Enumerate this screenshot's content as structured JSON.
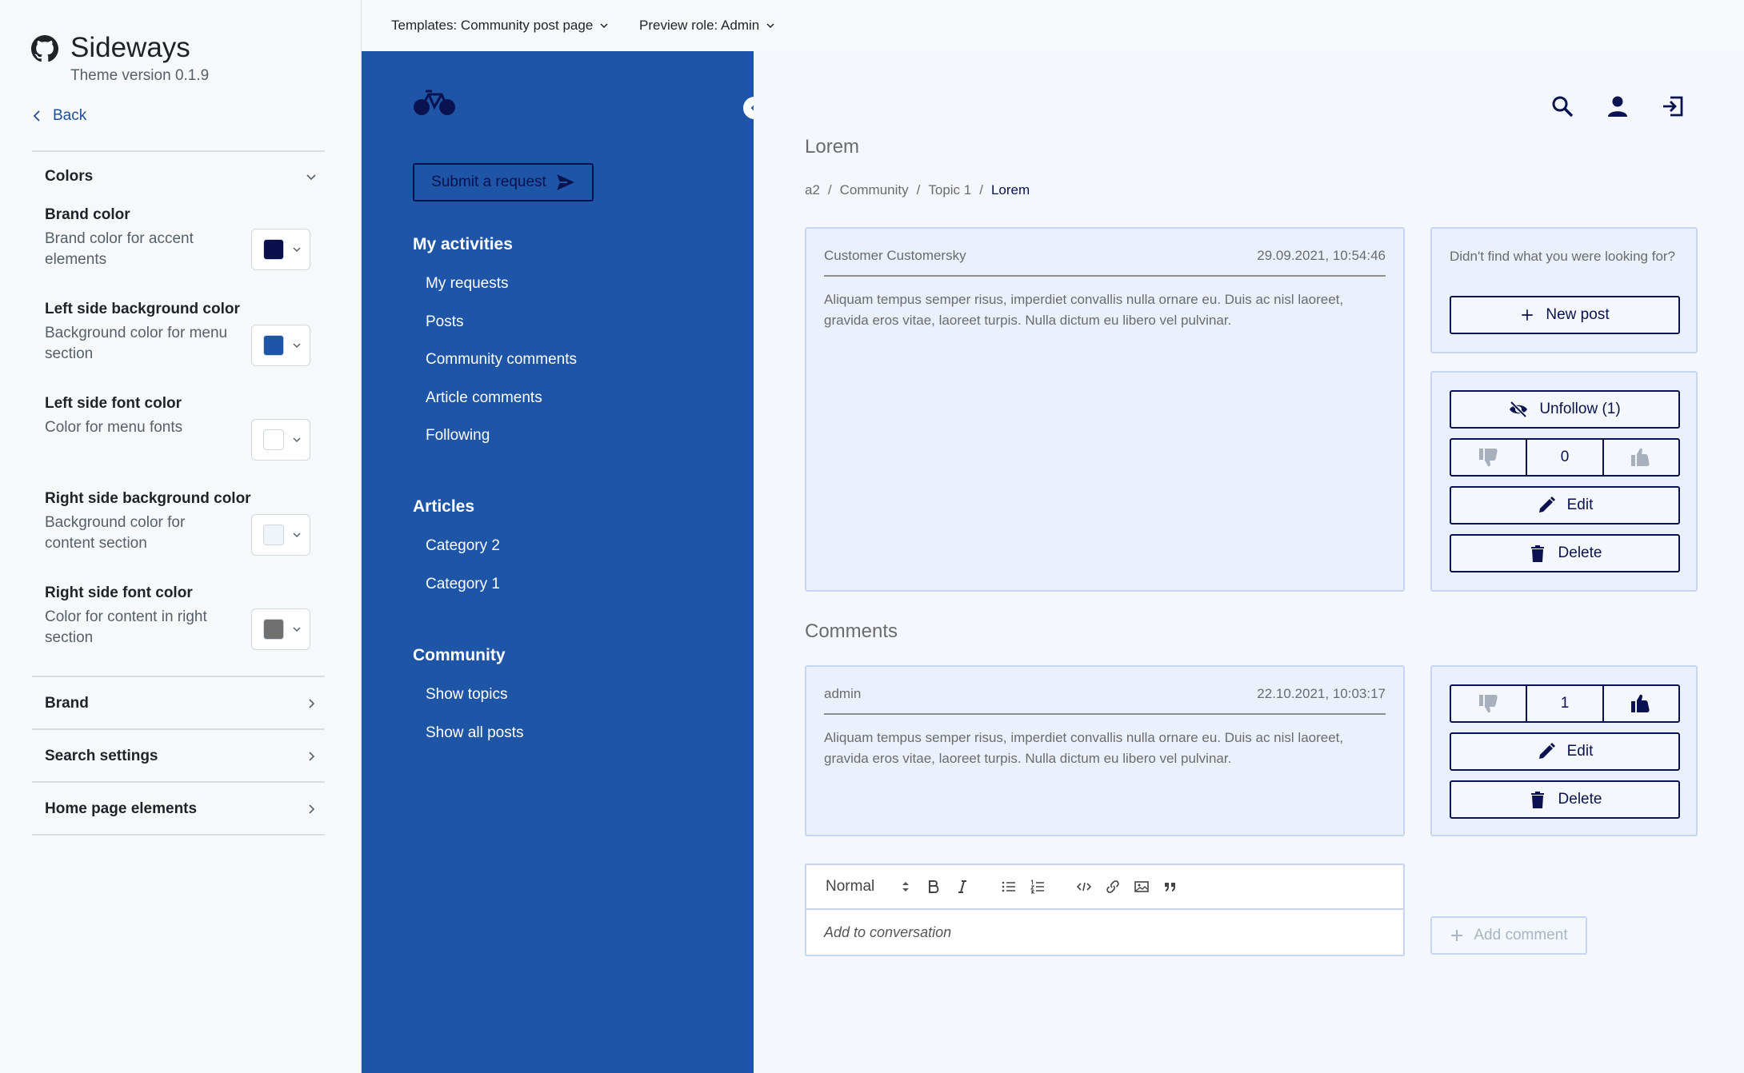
{
  "theme_panel": {
    "app_title": "Sideways",
    "version": "Theme version 0.1.9",
    "back_label": "Back",
    "colors_section": {
      "title": "Colors",
      "settings": [
        {
          "title": "Brand color",
          "description": "Brand color for accent elements",
          "value": "#0a0f4c"
        },
        {
          "title": "Left side background color",
          "description": "Background color for menu section",
          "value": "#1e55a6"
        },
        {
          "title": "Left side font color",
          "description": "Color for menu fonts",
          "value": "#ffffff"
        },
        {
          "title": "Right side background color",
          "description": "Background color for content section",
          "value": "#f0f4fb"
        },
        {
          "title": "Right side font color",
          "description": "Color for content in right section",
          "value": "#707070"
        }
      ]
    },
    "collapsed_sections": [
      "Brand",
      "Search settings",
      "Home page elements"
    ]
  },
  "top_bar": {
    "template_select": "Templates: Community post page",
    "role_select": "Preview role: Admin"
  },
  "menu": {
    "submit_label": "Submit a request",
    "groups": [
      {
        "heading": "My activities",
        "items": [
          "My requests",
          "Posts",
          "Community comments",
          "Article comments",
          "Following"
        ]
      },
      {
        "heading": "Articles",
        "items": [
          "Category 2",
          "Category 1"
        ]
      },
      {
        "heading": "Community",
        "items": [
          "Show topics",
          "Show all posts"
        ]
      }
    ]
  },
  "content": {
    "title": "Lorem",
    "breadcrumb": [
      "a2",
      "Community",
      "Topic 1",
      "Lorem"
    ],
    "post": {
      "author": "Customer Customersky",
      "timestamp": "29.09.2021, 10:54:46",
      "body": "Aliquam tempus semper risus, imperdiet convallis nulla ornare eu. Duis ac nisl laoreet, gravida eros vitae, laoreet turpis. Nulla dictum eu libero vel pulvinar."
    },
    "help_box": {
      "text": "Didn't find what you were looking for?",
      "new_post_label": "New post"
    },
    "post_actions": {
      "unfollow_label": "Unfollow (1)",
      "vote_count": "0",
      "edit_label": "Edit",
      "delete_label": "Delete"
    },
    "comments_heading": "Comments",
    "comment": {
      "author": "admin",
      "timestamp": "22.10.2021, 10:03:17",
      "body": "Aliquam tempus semper risus, imperdiet convallis nulla ornare eu. Duis ac nisl laoreet, gravida eros vitae, laoreet turpis. Nulla dictum eu libero vel pulvinar."
    },
    "comment_actions": {
      "vote_count": "1",
      "edit_label": "Edit",
      "delete_label": "Delete"
    },
    "editor": {
      "format_value": "Normal",
      "placeholder": "Add to conversation"
    },
    "add_comment_label": "Add comment"
  }
}
